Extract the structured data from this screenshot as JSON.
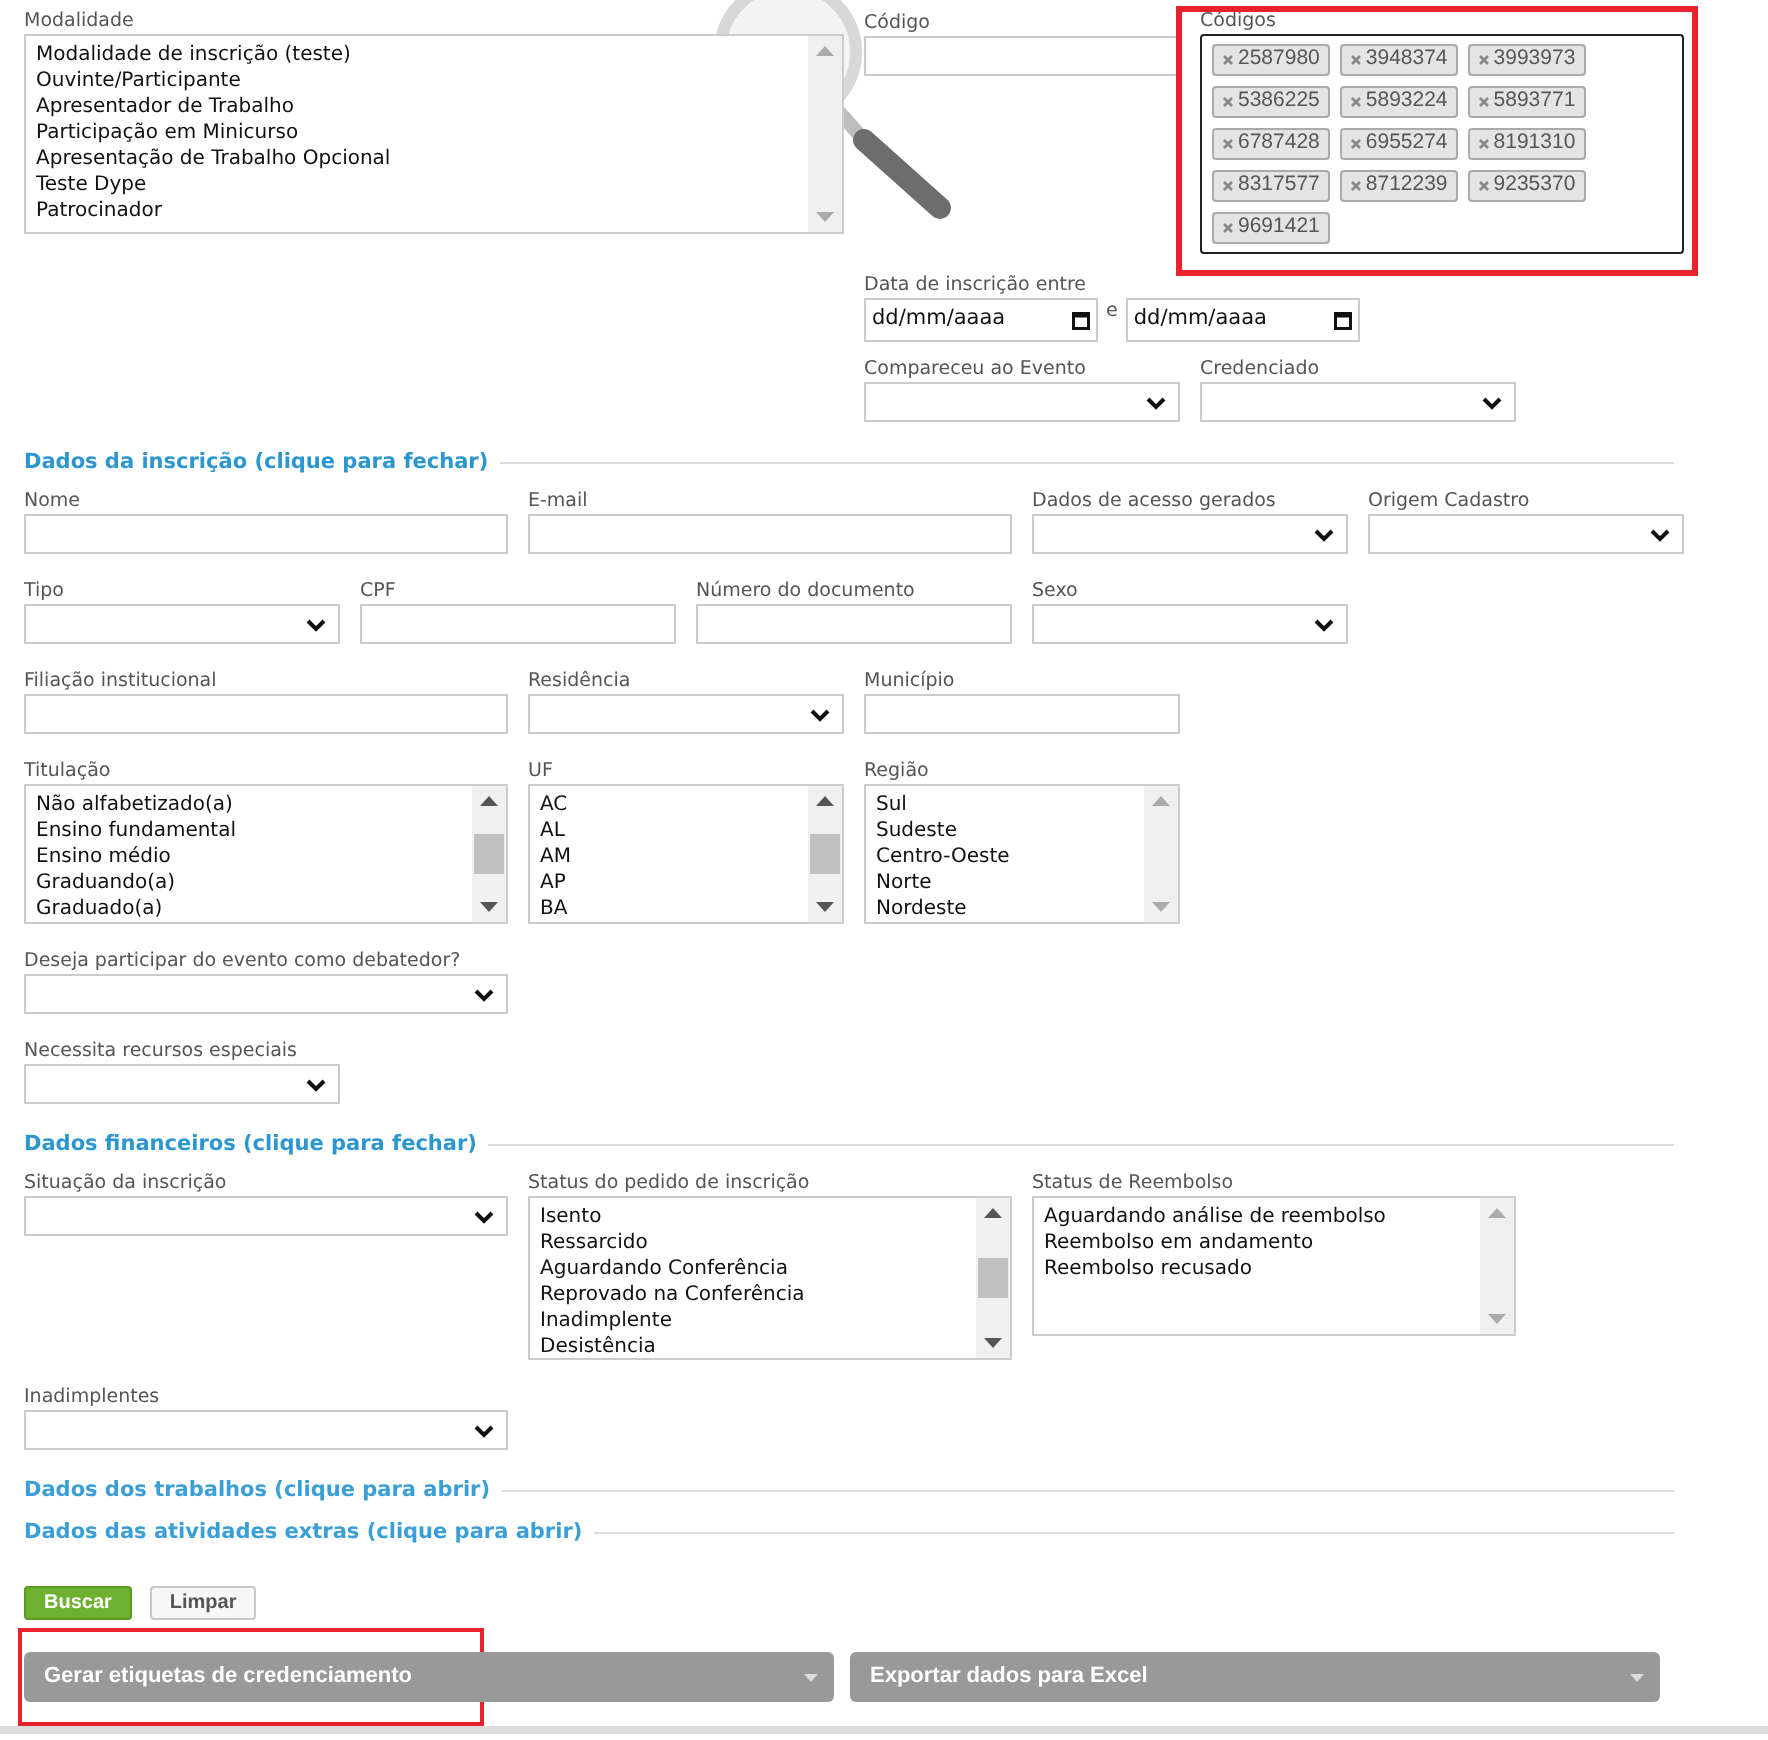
{
  "filters": {
    "modalidade": {
      "label": "Modalidade",
      "scrollable": false,
      "options": [
        "Modalidade de inscrição (teste)",
        "Ouvinte/Participante",
        "Apresentador de Trabalho",
        "Participação em Minicurso",
        "Apresentação de Trabalho Opcional",
        "Teste Dype",
        "Patrocinador"
      ]
    },
    "codigo": {
      "label": "Código"
    },
    "codigos": {
      "label": "Códigos",
      "highlighted": true,
      "tags": [
        "2587980",
        "3948374",
        "3993973",
        "5386225",
        "5893224",
        "5893771",
        "6787428",
        "6955274",
        "8191310",
        "8317577",
        "8712239",
        "9235370",
        "9691421"
      ]
    },
    "date_range": {
      "label": "Data de inscrição entre",
      "start": {
        "placeholder": "dd/mm/aaaa"
      },
      "separator": "e",
      "end": {
        "placeholder": "dd/mm/aaaa"
      }
    },
    "compareceu": {
      "label": "Compareceu ao Evento"
    },
    "credenciado": {
      "label": "Credenciado"
    }
  },
  "sections": [
    {
      "title": "Dados da inscrição (clique para fechar)",
      "expanded": true,
      "fields": [
        {
          "kind": "text",
          "label": "Nome"
        },
        {
          "kind": "text",
          "label": "E-mail"
        },
        {
          "kind": "select",
          "label": "Dados de acesso gerados"
        },
        {
          "kind": "select",
          "label": "Origem Cadastro"
        },
        {
          "kind": "select",
          "label": "Tipo"
        },
        {
          "kind": "text",
          "label": "CPF"
        },
        {
          "kind": "text",
          "label": "Número do documento"
        },
        {
          "kind": "select",
          "label": "Sexo"
        },
        {
          "kind": "text",
          "label": "Filiação institucional"
        },
        {
          "kind": "select",
          "label": "Residência"
        },
        {
          "kind": "text",
          "label": "Município"
        },
        {
          "kind": "listbox",
          "label": "Titulação",
          "scrollable": true,
          "options": [
            "Não alfabetizado(a)",
            "Ensino fundamental",
            "Ensino médio",
            "Graduando(a)",
            "Graduado(a)"
          ]
        },
        {
          "kind": "listbox",
          "label": "UF",
          "scrollable": true,
          "options": [
            "AC",
            "AL",
            "AM",
            "AP",
            "BA"
          ]
        },
        {
          "kind": "listbox",
          "label": "Região",
          "scrollable": false,
          "options": [
            "Sul",
            "Sudeste",
            "Centro-Oeste",
            "Norte",
            "Nordeste"
          ]
        },
        {
          "kind": "select",
          "label": "Deseja participar do evento como debatedor?"
        },
        {
          "kind": "select",
          "label": "Necessita recursos especiais"
        }
      ]
    },
    {
      "title": "Dados financeiros (clique para fechar)",
      "expanded": true,
      "fields": [
        {
          "kind": "select",
          "label": "Situação da inscrição"
        },
        {
          "kind": "listbox",
          "label": "Status do pedido de inscrição",
          "scrollable": true,
          "options": [
            "Isento",
            "Ressarcido",
            "Aguardando Conferência",
            "Reprovado na Conferência",
            "Inadimplente",
            "Desistência"
          ]
        },
        {
          "kind": "listbox",
          "label": "Status de Reembolso",
          "scrollable": false,
          "options": [
            "Aguardando análise de reembolso",
            "Reembolso em andamento",
            "Reembolso recusado"
          ]
        },
        {
          "kind": "select",
          "label": "Inadimplentes"
        }
      ]
    },
    {
      "title": "Dados dos trabalhos (clique para abrir)",
      "expanded": false
    },
    {
      "title": "Dados das atividades extras (clique para abrir)",
      "expanded": false
    }
  ],
  "buttons": [
    {
      "label": "Buscar",
      "kind": "primary"
    },
    {
      "label": "Limpar",
      "kind": "secondary"
    }
  ],
  "actions": [
    {
      "label": "Gerar etiquetas de credenciamento",
      "highlighted": true
    },
    {
      "label": "Exportar dados para Excel",
      "highlighted": false
    }
  ]
}
